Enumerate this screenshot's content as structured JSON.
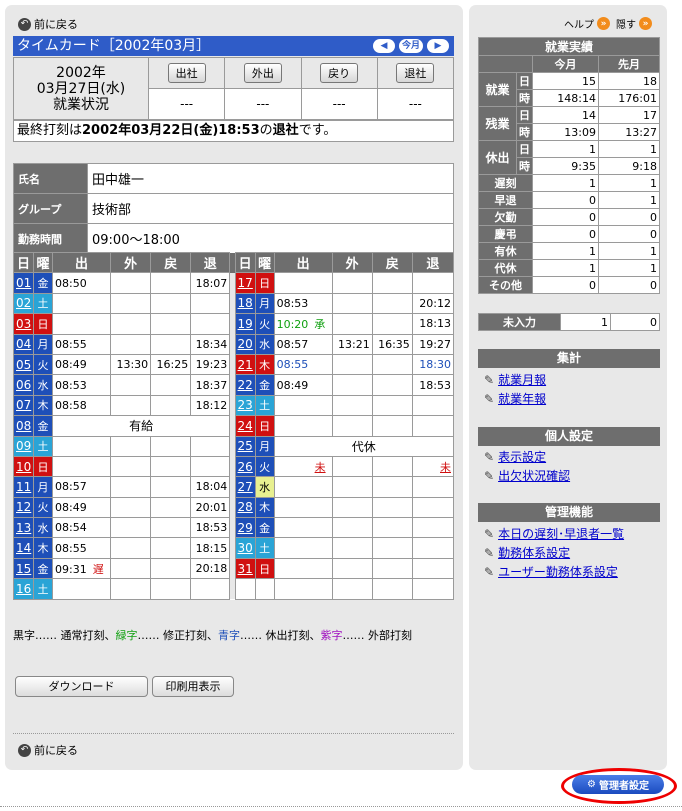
{
  "back_label": "前に戻る",
  "timecard_title": "タイムカード［2002年03月］",
  "nav": {
    "prev": "◀",
    "month": "今月",
    "next": "▶"
  },
  "date": {
    "year": "2002年",
    "day": "03月27日(水)",
    "status_label": "就業状況"
  },
  "status_buttons": [
    "出社",
    "外出",
    "戻り",
    "退社"
  ],
  "status_values": [
    "---",
    "---",
    "---",
    "---"
  ],
  "last_stamp": {
    "pre": "最終打刻は",
    "date": "2002年03月22日(金)18:53",
    "mid": "の",
    "kind": "退社",
    "post": "です。"
  },
  "info": [
    {
      "label": "氏名",
      "value": "田中雄一"
    },
    {
      "label": "グループ",
      "value": "技術部"
    },
    {
      "label": "勤務時間",
      "value": "09:00〜18:00"
    }
  ],
  "cal_headers": [
    "日",
    "曜",
    "出",
    "外",
    "戻",
    "退"
  ],
  "cal_left": [
    {
      "d": "01",
      "w": "金",
      "wc": "#1e4fb8",
      "in": "08:50",
      "o": "",
      "r": "",
      "out": "18:07"
    },
    {
      "d": "02",
      "w": "土",
      "wc": "#2aa4d6",
      "in": "",
      "o": "",
      "r": "",
      "out": ""
    },
    {
      "d": "03",
      "w": "日",
      "wc": "#d01010",
      "in": "",
      "o": "",
      "r": "",
      "out": ""
    },
    {
      "d": "04",
      "w": "月",
      "wc": "#1e4fb8",
      "in": "08:55",
      "o": "",
      "r": "",
      "out": "18:34"
    },
    {
      "d": "05",
      "w": "火",
      "wc": "#1e4fb8",
      "in": "08:49",
      "o": "13:30",
      "r": "16:25",
      "out": "19:23"
    },
    {
      "d": "06",
      "w": "水",
      "wc": "#1e4fb8",
      "in": "08:53",
      "o": "",
      "r": "",
      "out": "18:37"
    },
    {
      "d": "07",
      "w": "木",
      "wc": "#1e4fb8",
      "in": "08:58",
      "o": "",
      "r": "",
      "out": "18:12"
    },
    {
      "d": "08",
      "w": "金",
      "wc": "#1e4fb8",
      "in": "",
      "o": "",
      "r": "",
      "out": "",
      "span": "有給"
    },
    {
      "d": "09",
      "w": "土",
      "wc": "#2aa4d6",
      "in": "",
      "o": "",
      "r": "",
      "out": ""
    },
    {
      "d": "10",
      "w": "日",
      "wc": "#d01010",
      "in": "",
      "o": "",
      "r": "",
      "out": ""
    },
    {
      "d": "11",
      "w": "月",
      "wc": "#1e4fb8",
      "in": "08:57",
      "o": "",
      "r": "",
      "out": "18:04"
    },
    {
      "d": "12",
      "w": "火",
      "wc": "#1e4fb8",
      "in": "08:49",
      "o": "",
      "r": "",
      "out": "20:01"
    },
    {
      "d": "13",
      "w": "水",
      "wc": "#1e4fb8",
      "in": "08:54",
      "o": "",
      "r": "",
      "out": "18:53"
    },
    {
      "d": "14",
      "w": "木",
      "wc": "#1e4fb8",
      "in": "08:55",
      "o": "",
      "r": "",
      "out": "18:15"
    },
    {
      "d": "15",
      "w": "金",
      "wc": "#1e4fb8",
      "in": "09:31",
      "note": "遅",
      "o": "",
      "r": "",
      "out": "20:18"
    },
    {
      "d": "16",
      "w": "土",
      "wc": "#2aa4d6",
      "in": "",
      "o": "",
      "r": "",
      "out": ""
    }
  ],
  "cal_right": [
    {
      "d": "17",
      "w": "日",
      "wc": "#d01010",
      "in": "",
      "o": "",
      "r": "",
      "out": ""
    },
    {
      "d": "18",
      "w": "月",
      "wc": "#1e4fb8",
      "in": "08:53",
      "o": "",
      "r": "",
      "out": "20:12"
    },
    {
      "d": "19",
      "w": "火",
      "wc": "#1e4fb8",
      "in": "10:20",
      "inc": "#10a010",
      "note": "承",
      "notec": "#10a010",
      "o": "",
      "r": "",
      "out": "18:13"
    },
    {
      "d": "20",
      "w": "水",
      "wc": "#1e4fb8",
      "in": "08:57",
      "o": "13:21",
      "r": "16:35",
      "out": "19:27"
    },
    {
      "d": "21",
      "w": "木",
      "wc": "#d01010",
      "in": "08:55",
      "inc": "#1e4fb8",
      "o": "",
      "r": "",
      "out": "18:30",
      "outc": "#1e4fb8"
    },
    {
      "d": "22",
      "w": "金",
      "wc": "#1e4fb8",
      "in": "08:49",
      "o": "",
      "r": "",
      "out": "18:53"
    },
    {
      "d": "23",
      "w": "土",
      "wc": "#2aa4d6",
      "in": "",
      "o": "",
      "r": "",
      "out": ""
    },
    {
      "d": "24",
      "w": "日",
      "wc": "#d01010",
      "in": "",
      "o": "",
      "r": "",
      "out": ""
    },
    {
      "d": "25",
      "w": "月",
      "wc": "#1e4fb8",
      "in": "",
      "o": "",
      "r": "",
      "out": "",
      "span": "代休"
    },
    {
      "d": "26",
      "w": "火",
      "wc": "#1e4fb8",
      "in": "",
      "note": "未",
      "notec": "#d01010",
      "o": "",
      "r": "",
      "out": "未",
      "outc": "#d01010"
    },
    {
      "d": "27",
      "w": "水",
      "wc": "#e8f090",
      "wtc": "#000",
      "in": "",
      "o": "",
      "r": "",
      "out": ""
    },
    {
      "d": "28",
      "w": "木",
      "wc": "#1e4fb8",
      "in": "",
      "o": "",
      "r": "",
      "out": ""
    },
    {
      "d": "29",
      "w": "金",
      "wc": "#1e4fb8",
      "in": "",
      "o": "",
      "r": "",
      "out": ""
    },
    {
      "d": "30",
      "w": "土",
      "wc": "#2aa4d6",
      "in": "",
      "o": "",
      "r": "",
      "out": ""
    },
    {
      "d": "31",
      "w": "日",
      "wc": "#d01010",
      "in": "",
      "o": "",
      "r": "",
      "out": ""
    }
  ],
  "legend": [
    {
      "t": "黒字",
      "c": "#000",
      "s": "…… 通常打刻、"
    },
    {
      "t": "緑字",
      "c": "#10a010",
      "s": "…… 修正打刻、"
    },
    {
      "t": "青字",
      "c": "#1e4fb8",
      "s": "…… 休出打刻、"
    },
    {
      "t": "紫字",
      "c": "#a010c0",
      "s": "…… 外部打刻"
    }
  ],
  "download_label": "ダウンロード",
  "print_label": "印刷用表示",
  "help_label": "ヘルプ",
  "hide_label": "隠す",
  "jk": {
    "title": "就業実績",
    "cols": [
      "今月",
      "先月"
    ],
    "groups": [
      {
        "name": "就業",
        "rows": [
          {
            "k": "日",
            "a": "15",
            "b": "18"
          },
          {
            "k": "時",
            "a": "148:14",
            "b": "176:01"
          }
        ]
      },
      {
        "name": "残業",
        "rows": [
          {
            "k": "日",
            "a": "14",
            "b": "17"
          },
          {
            "k": "時",
            "a": "13:09",
            "b": "13:27"
          }
        ]
      },
      {
        "name": "休出",
        "rows": [
          {
            "k": "日",
            "a": "1",
            "b": "1"
          },
          {
            "k": "時",
            "a": "9:35",
            "b": "9:18"
          }
        ]
      }
    ],
    "singles": [
      {
        "k": "遅刻",
        "a": "1",
        "b": "1"
      },
      {
        "k": "早退",
        "a": "0",
        "b": "1"
      },
      {
        "k": "欠勤",
        "a": "0",
        "b": "0"
      },
      {
        "k": "慶弔",
        "a": "0",
        "b": "0"
      },
      {
        "k": "有休",
        "a": "1",
        "b": "1"
      },
      {
        "k": "代休",
        "a": "1",
        "b": "1"
      },
      {
        "k": "その他",
        "a": "0",
        "b": "0"
      }
    ]
  },
  "minyuryoku": {
    "k": "未入力",
    "a": "1",
    "b": "0"
  },
  "shukei": {
    "title": "集計",
    "links": [
      "就業月報",
      "就業年報"
    ]
  },
  "kojin": {
    "title": "個人設定",
    "links": [
      "表示設定",
      "出欠状況確認"
    ]
  },
  "kanri": {
    "title": "管理機能",
    "links": [
      "本日の遅刻･早退者一覧",
      "勤務体系設定",
      "ユーザー勤務体系設定"
    ]
  },
  "admin_label": "管理者設定"
}
